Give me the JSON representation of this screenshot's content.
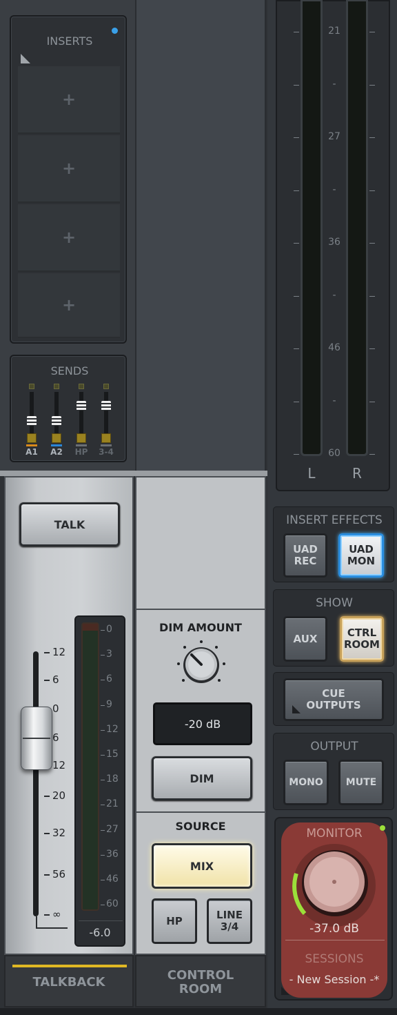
{
  "inserts": {
    "title": "INSERTS",
    "slots": [
      "+",
      "+",
      "+",
      "+"
    ]
  },
  "sends": {
    "title": "SENDS",
    "channels": [
      {
        "label": "A1",
        "color": "#d98a1a",
        "level": 0.3
      },
      {
        "label": "A2",
        "color": "#2a86d6",
        "level": 0.3
      },
      {
        "label": "HP",
        "color": "#6a6f75",
        "level": 0.75
      },
      {
        "label": "3-4",
        "color": "#6a6f75",
        "level": 0.75
      }
    ]
  },
  "meter": {
    "scale": [
      "21",
      "-",
      "27",
      "-",
      "36",
      "-",
      "46",
      "-",
      "60"
    ],
    "left_label": "L",
    "right_label": "R"
  },
  "talkback": {
    "talk_label": "TALK",
    "fader_scale": [
      "12",
      "6",
      "0",
      "6",
      "12",
      "20",
      "32",
      "56",
      "∞"
    ],
    "meter_scale": [
      "0",
      "3",
      "6",
      "9",
      "12",
      "15",
      "18",
      "21",
      "27",
      "36",
      "46",
      "60"
    ],
    "meter_readout": "-6.0",
    "footer": "TALKBACK"
  },
  "control_room": {
    "dim_amount_title": "DIM AMOUNT",
    "dim_value": "-20 dB",
    "dim_button": "DIM",
    "source_title": "SOURCE",
    "mix_button": "MIX",
    "hp_button": "HP",
    "line_button_l1": "LINE",
    "line_button_l2": "3/4",
    "footer_l1": "CONTROL",
    "footer_l2": "ROOM"
  },
  "right_panel": {
    "insert_effects_title": "INSERT EFFECTS",
    "uad_rec_l1": "UAD",
    "uad_rec_l2": "REC",
    "uad_mon_l1": "UAD",
    "uad_mon_l2": "MON",
    "show_title": "SHOW",
    "aux_button": "AUX",
    "ctrl_room_l1": "CTRL",
    "ctrl_room_l2": "ROOM",
    "cue_outputs_l1": "CUE",
    "cue_outputs_l2": "OUTPUTS",
    "output_title": "OUTPUT",
    "mono_button": "MONO",
    "mute_button": "MUTE",
    "monitor_title": "MONITOR",
    "monitor_value": "-37.0 dB",
    "sessions_title": "SESSIONS",
    "session_name": "- New Session -*",
    "monitor_color": "#8a3a36",
    "accent_green": "#9be03a"
  }
}
